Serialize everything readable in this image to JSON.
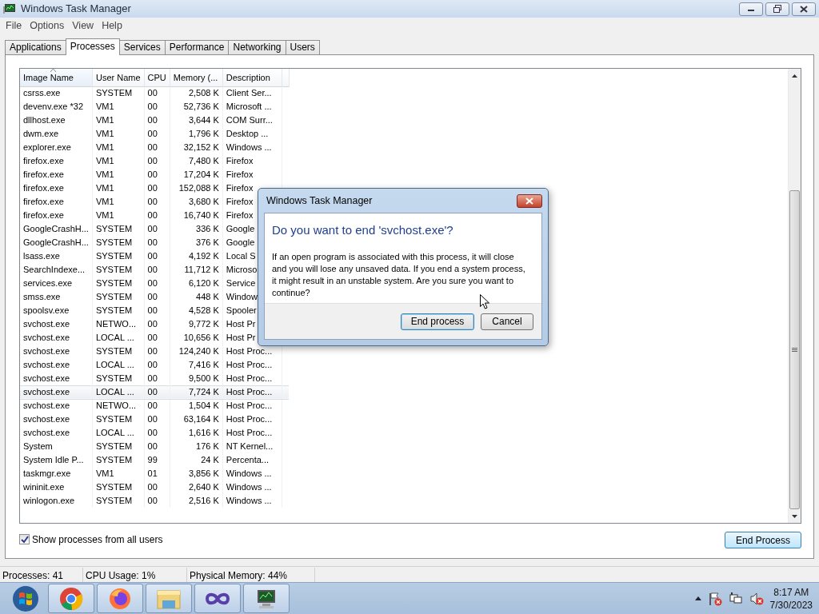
{
  "window": {
    "title": "Windows Task Manager"
  },
  "menu": [
    "File",
    "Options",
    "View",
    "Help"
  ],
  "tabs": [
    {
      "label": "Applications",
      "selected": false
    },
    {
      "label": "Processes",
      "selected": true
    },
    {
      "label": "Services",
      "selected": false
    },
    {
      "label": "Performance",
      "selected": false
    },
    {
      "label": "Networking",
      "selected": false
    },
    {
      "label": "Users",
      "selected": false
    }
  ],
  "table": {
    "columns": [
      {
        "label": "Image Name",
        "sorted": true
      },
      {
        "label": "User Name",
        "sorted": false
      },
      {
        "label": "CPU",
        "sorted": false
      },
      {
        "label": "Memory (...",
        "sorted": false
      },
      {
        "label": "Description",
        "sorted": false
      }
    ],
    "rows": [
      {
        "cells": [
          "csrss.exe",
          "SYSTEM",
          "00",
          "2,508 K",
          "Client Ser..."
        ],
        "selected": false
      },
      {
        "cells": [
          "devenv.exe *32",
          "VM1",
          "00",
          "52,736 K",
          "Microsoft ..."
        ],
        "selected": false
      },
      {
        "cells": [
          "dllhost.exe",
          "VM1",
          "00",
          "3,644 K",
          "COM Surr..."
        ],
        "selected": false
      },
      {
        "cells": [
          "dwm.exe",
          "VM1",
          "00",
          "1,796 K",
          "Desktop ..."
        ],
        "selected": false
      },
      {
        "cells": [
          "explorer.exe",
          "VM1",
          "00",
          "32,152 K",
          "Windows ..."
        ],
        "selected": false
      },
      {
        "cells": [
          "firefox.exe",
          "VM1",
          "00",
          "7,480 K",
          "Firefox"
        ],
        "selected": false
      },
      {
        "cells": [
          "firefox.exe",
          "VM1",
          "00",
          "17,204 K",
          "Firefox"
        ],
        "selected": false
      },
      {
        "cells": [
          "firefox.exe",
          "VM1",
          "00",
          "152,088 K",
          "Firefox"
        ],
        "selected": false
      },
      {
        "cells": [
          "firefox.exe",
          "VM1",
          "00",
          "3,680 K",
          "Firefox"
        ],
        "selected": false
      },
      {
        "cells": [
          "firefox.exe",
          "VM1",
          "00",
          "16,740 K",
          "Firefox"
        ],
        "selected": false
      },
      {
        "cells": [
          "GoogleCrashH...",
          "SYSTEM",
          "00",
          "336 K",
          "Google"
        ],
        "selected": false
      },
      {
        "cells": [
          "GoogleCrashH...",
          "SYSTEM",
          "00",
          "376 K",
          "Google"
        ],
        "selected": false
      },
      {
        "cells": [
          "lsass.exe",
          "SYSTEM",
          "00",
          "4,192 K",
          "Local S"
        ],
        "selected": false
      },
      {
        "cells": [
          "SearchIndexe...",
          "SYSTEM",
          "00",
          "11,712 K",
          "Microso"
        ],
        "selected": false
      },
      {
        "cells": [
          "services.exe",
          "SYSTEM",
          "00",
          "6,120 K",
          "Service"
        ],
        "selected": false
      },
      {
        "cells": [
          "smss.exe",
          "SYSTEM",
          "00",
          "448 K",
          "Window"
        ],
        "selected": false
      },
      {
        "cells": [
          "spoolsv.exe",
          "SYSTEM",
          "00",
          "4,528 K",
          "Spooler"
        ],
        "selected": false
      },
      {
        "cells": [
          "svchost.exe",
          "NETWO...",
          "00",
          "9,772 K",
          "Host Pr"
        ],
        "selected": false
      },
      {
        "cells": [
          "svchost.exe",
          "LOCAL ...",
          "00",
          "10,656 K",
          "Host Pr"
        ],
        "selected": false
      },
      {
        "cells": [
          "svchost.exe",
          "SYSTEM",
          "00",
          "124,240 K",
          "Host Proc..."
        ],
        "selected": false
      },
      {
        "cells": [
          "svchost.exe",
          "LOCAL ...",
          "00",
          "7,416 K",
          "Host Proc..."
        ],
        "selected": false
      },
      {
        "cells": [
          "svchost.exe",
          "SYSTEM",
          "00",
          "9,500 K",
          "Host Proc..."
        ],
        "selected": false
      },
      {
        "cells": [
          "svchost.exe",
          "LOCAL ...",
          "00",
          "7,724 K",
          "Host Proc..."
        ],
        "selected": true
      },
      {
        "cells": [
          "svchost.exe",
          "NETWO...",
          "00",
          "1,504 K",
          "Host Proc..."
        ],
        "selected": false
      },
      {
        "cells": [
          "svchost.exe",
          "SYSTEM",
          "00",
          "63,164 K",
          "Host Proc..."
        ],
        "selected": false
      },
      {
        "cells": [
          "svchost.exe",
          "LOCAL ...",
          "00",
          "1,616 K",
          "Host Proc..."
        ],
        "selected": false
      },
      {
        "cells": [
          "System",
          "SYSTEM",
          "00",
          "176 K",
          "NT Kernel..."
        ],
        "selected": false
      },
      {
        "cells": [
          "System Idle P...",
          "SYSTEM",
          "99",
          "24 K",
          "Percenta..."
        ],
        "selected": false
      },
      {
        "cells": [
          "taskmgr.exe",
          "VM1",
          "01",
          "3,856 K",
          "Windows ..."
        ],
        "selected": false
      },
      {
        "cells": [
          "wininit.exe",
          "SYSTEM",
          "00",
          "2,640 K",
          "Windows ..."
        ],
        "selected": false
      },
      {
        "cells": [
          "winlogon.exe",
          "SYSTEM",
          "00",
          "2,516 K",
          "Windows ..."
        ],
        "selected": false
      }
    ]
  },
  "show_all_users": {
    "label": "Show processes from all users",
    "checked": true
  },
  "end_process_button": "End Process",
  "status_bar": [
    "Processes: 41",
    "CPU Usage: 1%",
    "Physical Memory: 44%"
  ],
  "dialog": {
    "title": "Windows Task Manager",
    "heading": "Do you want to end 'svchost.exe'?",
    "message": "If an open program is associated with this process, it will close and you will lose any unsaved data. If you end a system process, it might result in an unstable system. Are you sure you want to continue?",
    "buttons": [
      {
        "label": "End process",
        "default": true
      },
      {
        "label": "Cancel",
        "default": false
      }
    ]
  },
  "clock": {
    "time": "8:17 AM",
    "date": "7/30/2023"
  }
}
